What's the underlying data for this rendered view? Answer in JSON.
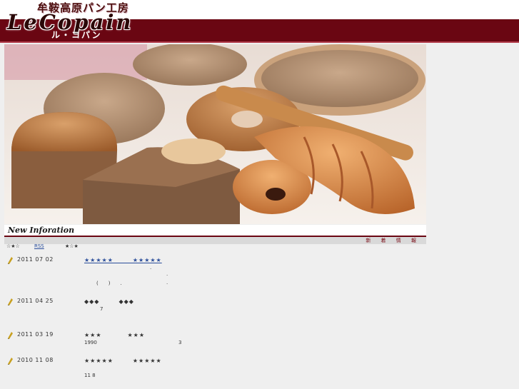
{
  "header": {
    "jp_top": "牟鞍高原パン工房",
    "logo": "LeCopain",
    "jp_bottom": "ル・コパン"
  },
  "news": {
    "title": "New Inforation",
    "bar_label": "新 着 情 報",
    "meta_left": "☆★☆",
    "rss_label": "RSS",
    "meta_right": "★☆★"
  },
  "entries": [
    {
      "date": "2011 07 02",
      "title": "★★★★★　　　★★★★★",
      "lines": [
        ".",
        ".",
        "(　　)　　.",
        "."
      ]
    },
    {
      "date": "2011 04 25",
      "title": "◆◆◆　　　◆◆◆",
      "lines": [
        "7"
      ]
    },
    {
      "date": "2011 03 19",
      "title": "★★★　　　　★★★",
      "lines": [
        "1990",
        "3"
      ]
    },
    {
      "date": "2010 11 08",
      "title": "★★★★★　　　★★★★★",
      "lines": [
        "11 8"
      ]
    }
  ],
  "colors": {
    "brand_red": "#6a0612",
    "link_blue": "#2a4d9a",
    "page_bg": "#efefef"
  }
}
